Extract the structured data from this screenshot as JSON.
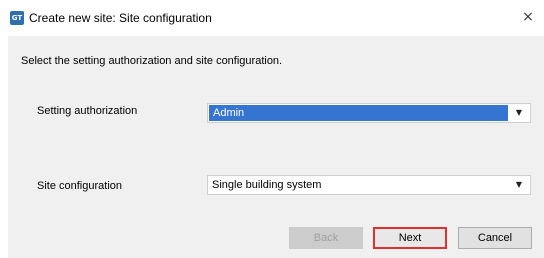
{
  "window": {
    "title": "Create new site: Site configuration",
    "icon_text": "GT",
    "close_glyph": "×"
  },
  "dialog": {
    "instruction": "Select the setting authorization and site configuration.",
    "setting_authorization": {
      "label": "Setting authorization",
      "value": "Admin"
    },
    "site_configuration": {
      "label": "Site configuration",
      "value": "Single building system"
    }
  },
  "buttons": {
    "back": "Back",
    "next": "Next",
    "cancel": "Cancel"
  },
  "colors": {
    "selection": "#3574d0",
    "highlight_border": "#e0302f",
    "app_icon": "#2f6fae"
  },
  "icons": {
    "dropdown": "chevron-down-icon",
    "close": "close-icon",
    "app": "app-icon"
  }
}
